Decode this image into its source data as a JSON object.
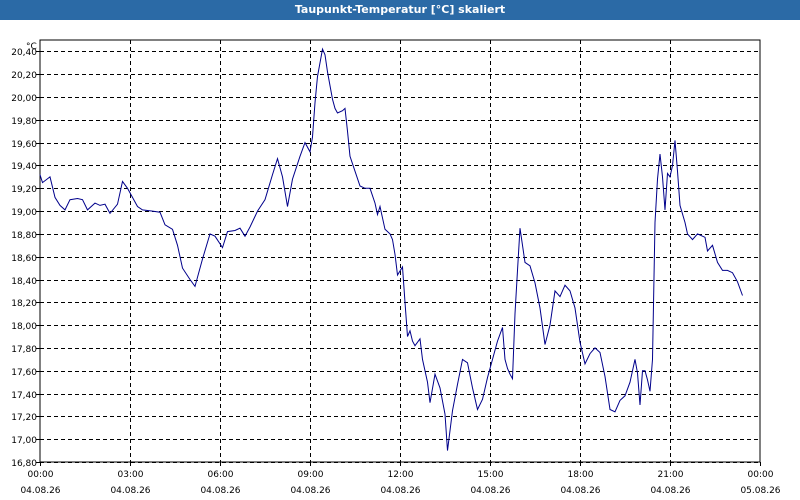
{
  "window": {
    "title": "Taupunkt-Temperatur [°C] skaliert"
  },
  "chart_data": {
    "type": "line",
    "title": "Taupunkt-Temperatur [°C] skaliert",
    "unit_label": "°C",
    "ylim": [
      16.8,
      20.5
    ],
    "grid": true,
    "y_ticks": [
      "16,80",
      "17,00",
      "17,20",
      "17,40",
      "17,60",
      "17,80",
      "18,00",
      "18,20",
      "18,40",
      "18,60",
      "18,80",
      "19,00",
      "19,20",
      "19,40",
      "19,60",
      "19,80",
      "20,00",
      "20,20",
      "20,40"
    ],
    "x_ticks": [
      {
        "time": "00:00",
        "date": "04.08.26"
      },
      {
        "time": "03:00",
        "date": "04.08.26"
      },
      {
        "time": "06:00",
        "date": "04.08.26"
      },
      {
        "time": "09:00",
        "date": "04.08.26"
      },
      {
        "time": "12:00",
        "date": "04.08.26"
      },
      {
        "time": "15:00",
        "date": "04.08.26"
      },
      {
        "time": "18:00",
        "date": "04.08.26"
      },
      {
        "time": "21:00",
        "date": "04.08.26"
      },
      {
        "time": "00:00",
        "date": "05.08.26"
      }
    ],
    "series": [
      {
        "color": "#00008b",
        "points": [
          [
            "04.08.26 00:00",
            19.32
          ],
          [
            "04.08.26 00:05",
            19.25
          ],
          [
            "04.08.26 00:20",
            19.3
          ],
          [
            "04.08.26 00:30",
            19.12
          ],
          [
            "04.08.26 00:40",
            19.05
          ],
          [
            "04.08.26 00:50",
            19.01
          ],
          [
            "04.08.26 01:00",
            19.1
          ],
          [
            "04.08.26 01:15",
            19.11
          ],
          [
            "04.08.26 01:25",
            19.1
          ],
          [
            "04.08.26 01:35",
            19.01
          ],
          [
            "04.08.26 01:50",
            19.07
          ],
          [
            "04.08.26 02:00",
            19.05
          ],
          [
            "04.08.26 02:10",
            19.06
          ],
          [
            "04.08.26 02:20",
            18.98
          ],
          [
            "04.08.26 02:35",
            19.06
          ],
          [
            "04.08.26 02:45",
            19.26
          ],
          [
            "04.08.26 02:55",
            19.2
          ],
          [
            "04.08.26 03:15",
            19.04
          ],
          [
            "04.08.26 03:25",
            19.01
          ],
          [
            "04.08.26 03:45",
            19.0
          ],
          [
            "04.08.26 04:00",
            18.99
          ],
          [
            "04.08.26 04:10",
            18.88
          ],
          [
            "04.08.26 04:25",
            18.84
          ],
          [
            "04.08.26 04:35",
            18.7
          ],
          [
            "04.08.26 04:45",
            18.5
          ],
          [
            "04.08.26 05:00",
            18.4
          ],
          [
            "04.08.26 05:10",
            18.34
          ],
          [
            "04.08.26 05:25",
            18.58
          ],
          [
            "04.08.26 05:40",
            18.8
          ],
          [
            "04.08.26 05:50",
            18.78
          ],
          [
            "04.08.26 06:05",
            18.68
          ],
          [
            "04.08.26 06:15",
            18.82
          ],
          [
            "04.08.26 06:30",
            18.83
          ],
          [
            "04.08.26 06:40",
            18.85
          ],
          [
            "04.08.26 06:50",
            18.78
          ],
          [
            "04.08.26 07:00",
            18.86
          ],
          [
            "04.08.26 07:15",
            19.0
          ],
          [
            "04.08.26 07:30",
            19.1
          ],
          [
            "04.08.26 07:45",
            19.32
          ],
          [
            "04.08.26 07:55",
            19.46
          ],
          [
            "04.08.26 08:05",
            19.3
          ],
          [
            "04.08.26 08:15",
            19.04
          ],
          [
            "04.08.26 08:25",
            19.28
          ],
          [
            "04.08.26 08:40",
            19.48
          ],
          [
            "04.08.26 08:50",
            19.6
          ],
          [
            "04.08.26 09:00",
            19.52
          ],
          [
            "04.08.26 09:05",
            19.65
          ],
          [
            "04.08.26 09:10",
            19.95
          ],
          [
            "04.08.26 09:15",
            20.18
          ],
          [
            "04.08.26 09:20",
            20.3
          ],
          [
            "04.08.26 09:25",
            20.42
          ],
          [
            "04.08.26 09:30",
            20.37
          ],
          [
            "04.08.26 09:35",
            20.22
          ],
          [
            "04.08.26 09:40",
            20.1
          ],
          [
            "04.08.26 09:45",
            19.98
          ],
          [
            "04.08.26 09:50",
            19.9
          ],
          [
            "04.08.26 09:55",
            19.86
          ],
          [
            "04.08.26 10:05",
            19.88
          ],
          [
            "04.08.26 10:10",
            19.9
          ],
          [
            "04.08.26 10:15",
            19.7
          ],
          [
            "04.08.26 10:20",
            19.48
          ],
          [
            "04.08.26 10:30",
            19.35
          ],
          [
            "04.08.26 10:40",
            19.22
          ],
          [
            "04.08.26 10:50",
            19.2
          ],
          [
            "04.08.26 11:00",
            19.2
          ],
          [
            "04.08.26 11:10",
            19.07
          ],
          [
            "04.08.26 11:15",
            18.97
          ],
          [
            "04.08.26 11:20",
            19.04
          ],
          [
            "04.08.26 11:30",
            18.84
          ],
          [
            "04.08.26 11:40",
            18.8
          ],
          [
            "04.08.26 11:45",
            18.75
          ],
          [
            "04.08.26 11:50",
            18.62
          ],
          [
            "04.08.26 11:55",
            18.44
          ],
          [
            "04.08.26 12:05",
            18.51
          ],
          [
            "04.08.26 12:10",
            18.2
          ],
          [
            "04.08.26 12:15",
            17.9
          ],
          [
            "04.08.26 12:20",
            17.95
          ],
          [
            "04.08.26 12:25",
            17.86
          ],
          [
            "04.08.26 12:30",
            17.82
          ],
          [
            "04.08.26 12:40",
            17.88
          ],
          [
            "04.08.26 12:45",
            17.7
          ],
          [
            "04.08.26 12:55",
            17.5
          ],
          [
            "04.08.26 13:00",
            17.32
          ],
          [
            "04.08.26 13:10",
            17.57
          ],
          [
            "04.08.26 13:20",
            17.45
          ],
          [
            "04.08.26 13:30",
            17.22
          ],
          [
            "04.08.26 13:35",
            16.9
          ],
          [
            "04.08.26 13:45",
            17.25
          ],
          [
            "04.08.26 13:55",
            17.48
          ],
          [
            "04.08.26 14:05",
            17.7
          ],
          [
            "04.08.26 14:15",
            17.67
          ],
          [
            "04.08.26 14:25",
            17.45
          ],
          [
            "04.08.26 14:35",
            17.26
          ],
          [
            "04.08.26 14:45",
            17.35
          ],
          [
            "04.08.26 14:55",
            17.54
          ],
          [
            "04.08.26 15:05",
            17.7
          ],
          [
            "04.08.26 15:15",
            17.86
          ],
          [
            "04.08.26 15:25",
            17.98
          ],
          [
            "04.08.26 15:30",
            17.7
          ],
          [
            "04.08.26 15:35",
            17.62
          ],
          [
            "04.08.26 15:40",
            17.57
          ],
          [
            "04.08.26 15:45",
            17.53
          ],
          [
            "04.08.26 15:50",
            18.1
          ],
          [
            "04.08.26 15:55",
            18.48
          ],
          [
            "04.08.26 16:00",
            18.85
          ],
          [
            "04.08.26 16:05",
            18.7
          ],
          [
            "04.08.26 16:10",
            18.55
          ],
          [
            "04.08.26 16:20",
            18.52
          ],
          [
            "04.08.26 16:30",
            18.37
          ],
          [
            "04.08.26 16:40",
            18.15
          ],
          [
            "04.08.26 16:50",
            17.83
          ],
          [
            "04.08.26 17:00",
            18.0
          ],
          [
            "04.08.26 17:10",
            18.3
          ],
          [
            "04.08.26 17:20",
            18.25
          ],
          [
            "04.08.26 17:30",
            18.35
          ],
          [
            "04.08.26 17:40",
            18.3
          ],
          [
            "04.08.26 17:50",
            18.15
          ],
          [
            "04.08.26 18:00",
            17.85
          ],
          [
            "04.08.26 18:10",
            17.66
          ],
          [
            "04.08.26 18:20",
            17.75
          ],
          [
            "04.08.26 18:30",
            17.8
          ],
          [
            "04.08.26 18:40",
            17.76
          ],
          [
            "04.08.26 18:50",
            17.55
          ],
          [
            "04.08.26 19:00",
            17.26
          ],
          [
            "04.08.26 19:10",
            17.24
          ],
          [
            "04.08.26 19:20",
            17.34
          ],
          [
            "04.08.26 19:30",
            17.38
          ],
          [
            "04.08.26 19:40",
            17.5
          ],
          [
            "04.08.26 19:50",
            17.7
          ],
          [
            "04.08.26 19:55",
            17.58
          ],
          [
            "04.08.26 20:00",
            17.3
          ],
          [
            "04.08.26 20:05",
            17.6
          ],
          [
            "04.08.26 20:10",
            17.6
          ],
          [
            "04.08.26 20:15",
            17.52
          ],
          [
            "04.08.26 20:20",
            17.42
          ],
          [
            "04.08.26 20:25",
            17.7
          ],
          [
            "04.08.26 20:30",
            18.9
          ],
          [
            "04.08.26 20:35",
            19.28
          ],
          [
            "04.08.26 20:40",
            19.5
          ],
          [
            "04.08.26 20:45",
            19.3
          ],
          [
            "04.08.26 20:50",
            19.01
          ],
          [
            "04.08.26 20:55",
            19.33
          ],
          [
            "04.08.26 21:00",
            19.3
          ],
          [
            "04.08.26 21:05",
            19.4
          ],
          [
            "04.08.26 21:10",
            19.62
          ],
          [
            "04.08.26 21:15",
            19.35
          ],
          [
            "04.08.26 21:20",
            19.05
          ],
          [
            "04.08.26 21:30",
            18.9
          ],
          [
            "04.08.26 21:35",
            18.8
          ],
          [
            "04.08.26 21:45",
            18.75
          ],
          [
            "04.08.26 21:55",
            18.8
          ],
          [
            "04.08.26 22:10",
            18.77
          ],
          [
            "04.08.26 22:15",
            18.65
          ],
          [
            "04.08.26 22:25",
            18.7
          ],
          [
            "04.08.26 22:35",
            18.55
          ],
          [
            "04.08.26 22:45",
            18.48
          ],
          [
            "04.08.26 22:55",
            18.48
          ],
          [
            "04.08.26 23:05",
            18.46
          ],
          [
            "04.08.26 23:15",
            18.38
          ],
          [
            "04.08.26 23:25",
            18.26
          ]
        ]
      }
    ]
  }
}
